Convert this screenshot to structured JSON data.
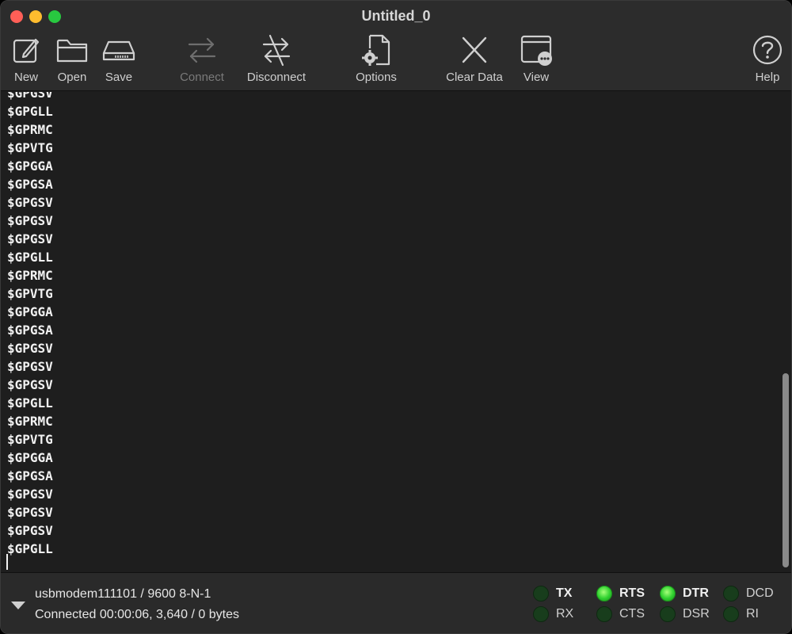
{
  "window": {
    "title": "Untitled_0"
  },
  "toolbar": {
    "new_label": "New",
    "open_label": "Open",
    "save_label": "Save",
    "connect_label": "Connect",
    "disconnect_label": "Disconnect",
    "options_label": "Options",
    "clear_label": "Clear Data",
    "view_label": "View",
    "help_label": "Help"
  },
  "terminal": {
    "lines": [
      "$GPGSV",
      "$GPGLL",
      "$GPRMC",
      "$GPVTG",
      "$GPGGA",
      "$GPGSA",
      "$GPGSV",
      "$GPGSV",
      "$GPGSV",
      "$GPGLL",
      "$GPRMC",
      "$GPVTG",
      "$GPGGA",
      "$GPGSA",
      "$GPGSV",
      "$GPGSV",
      "$GPGSV",
      "$GPGLL",
      "$GPRMC",
      "$GPVTG",
      "$GPGGA",
      "$GPGSA",
      "$GPGSV",
      "$GPGSV",
      "$GPGSV",
      "$GPGLL"
    ]
  },
  "status": {
    "port": "usbmodem111101 / 9600 8-N-1",
    "connection": "Connected 00:00:06, 3,640 / 0 bytes"
  },
  "signals": {
    "tx": "TX",
    "rx": "RX",
    "rts": "RTS",
    "cts": "CTS",
    "dtr": "DTR",
    "dsr": "DSR",
    "dcd": "DCD",
    "ri": "RI"
  },
  "colors": {
    "led_on": "#2fd12f",
    "led_off": "#183d1c"
  }
}
